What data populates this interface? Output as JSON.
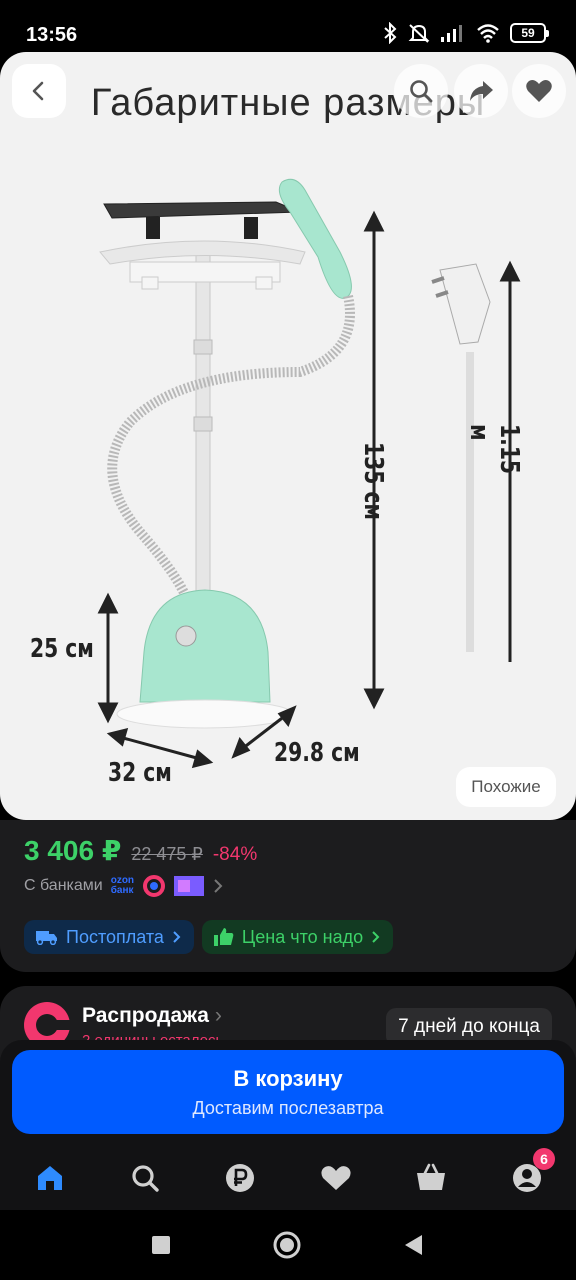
{
  "status_bar": {
    "time": "13:56",
    "battery": "59"
  },
  "image": {
    "title": "Габаритные размеры",
    "similar_label": "Похожие",
    "dimensions": {
      "height_total": "135 см",
      "cord_length": "1.15 м",
      "base_height": "25 см",
      "depth": "32 см",
      "width": "29.8 см"
    }
  },
  "product": {
    "price": "3 406 ₽",
    "old_price": "22 475 ₽",
    "discount": "-84%",
    "banks_label": "С банками",
    "ozon_bank_line1": "ozon",
    "ozon_bank_line2": "банк",
    "chips": {
      "postpay": "Постоплата",
      "good_price": "Цена что надо"
    }
  },
  "sale": {
    "title": "Распродажа",
    "subtitle": "2 единицы осталось",
    "days_left": "7 дней до конца"
  },
  "cart": {
    "label": "В корзину",
    "delivery": "Доставим послезавтра"
  },
  "nav": {
    "profile_badge": "6"
  },
  "colors": {
    "accent_blue": "#005bff",
    "price_green": "#3dd168",
    "discount_pink": "#f2376e",
    "steamer_mint": "#a8e6cf"
  }
}
